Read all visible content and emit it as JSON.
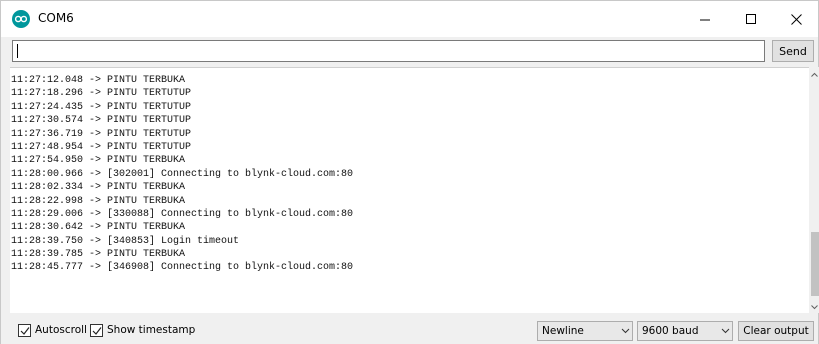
{
  "window": {
    "title": "COM6",
    "icon": "arduino-infinity-icon",
    "controls": [
      "minimize-icon",
      "maximize-icon",
      "close-icon"
    ]
  },
  "input": {
    "value": "",
    "send_label": "Send"
  },
  "output": {
    "lines": [
      "11:27:12.048 -> PINTU TERBUKA",
      "11:27:18.296 -> PINTU TERTUTUP",
      "11:27:24.435 -> PINTU TERTUTUP",
      "11:27:30.574 -> PINTU TERTUTUP",
      "11:27:36.719 -> PINTU TERTUTUP",
      "11:27:48.954 -> PINTU TERTUTUP",
      "11:27:54.950 -> PINTU TERBUKA",
      "11:28:00.966 -> [302001] Connecting to blynk-cloud.com:80",
      "11:28:02.334 -> PINTU TERBUKA",
      "11:28:22.998 -> PINTU TERBUKA",
      "11:28:29.006 -> [330088] Connecting to blynk-cloud.com:80",
      "11:28:30.642 -> PINTU TERBUKA",
      "11:28:39.750 -> [340853] Login timeout",
      "11:28:39.785 -> PINTU TERBUKA",
      "11:28:45.777 -> [346908] Connecting to blynk-cloud.com:80"
    ]
  },
  "footer": {
    "autoscroll": {
      "label": "Autoscroll",
      "checked": true
    },
    "show_timestamp": {
      "label": "Show timestamp",
      "checked": true
    },
    "line_ending": "Newline",
    "baud_rate": "9600 baud",
    "clear_label": "Clear output"
  },
  "colors": {
    "accent": "#00979c",
    "chrome": "#f0f0f0",
    "scroll_thumb": "#c2c2c2"
  }
}
